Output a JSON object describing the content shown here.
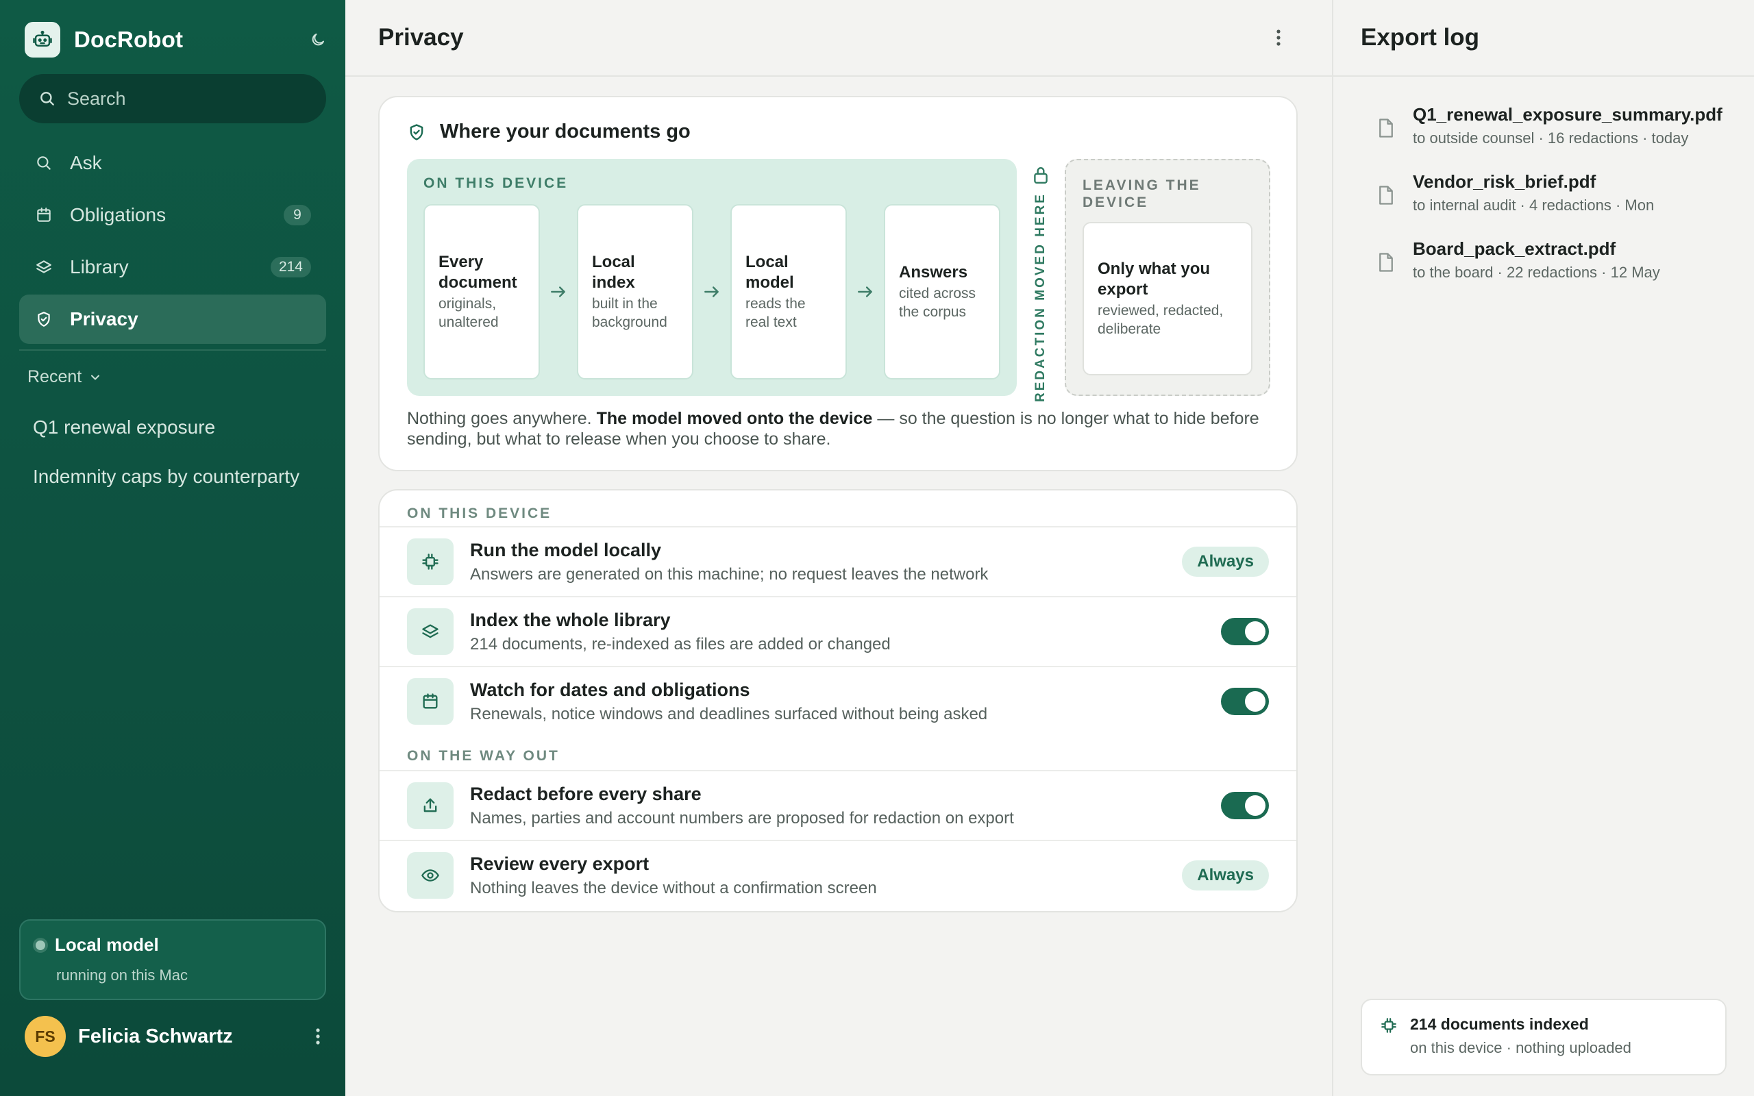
{
  "app": {
    "name": "DocRobot",
    "search_placeholder": "Search"
  },
  "sidebar": {
    "nav": [
      {
        "label": "Ask",
        "icon": "search-icon"
      },
      {
        "label": "Obligations",
        "icon": "calendar-icon",
        "count": "9"
      },
      {
        "label": "Library",
        "icon": "layers-icon",
        "count": "214"
      },
      {
        "label": "Privacy",
        "icon": "shield-check-icon",
        "active": true
      }
    ],
    "recent_label": "Recent",
    "recent": [
      "Q1 renewal exposure",
      "Indemnity caps by counterparty"
    ],
    "local_model": {
      "title": "Local model",
      "subtitle": "running on this Mac"
    },
    "user": {
      "initials": "FS",
      "name": "Felicia Schwartz"
    }
  },
  "main": {
    "title": "Privacy",
    "flow": {
      "title": "Where your documents go",
      "device_label": "ON THIS DEVICE",
      "steps": [
        {
          "title": "Every document",
          "sub": "originals, unaltered"
        },
        {
          "title": "Local index",
          "sub": "built in the background"
        },
        {
          "title": "Local model",
          "sub": "reads the real text"
        },
        {
          "title": "Answers",
          "sub": "cited across the corpus"
        }
      ],
      "boundary_label": "REDACTION MOVED HERE",
      "leaving_label": "LEAVING THE DEVICE",
      "leaving_step": {
        "title": "Only what you export",
        "sub": "reviewed, redacted, deliberate"
      },
      "note_prefix": "Nothing goes anywhere. ",
      "note_bold": "The model moved onto the device",
      "note_suffix": " — so the question is no longer what to hide before sending, but what to release when you choose to share."
    },
    "settings": {
      "section_device": "ON THIS DEVICE",
      "section_out": "ON THE WAY OUT",
      "rows": [
        {
          "title": "Run the model locally",
          "sub": "Answers are generated on this machine; no request leaves the network",
          "control": "pill",
          "pill": "Always",
          "icon": "chip-icon"
        },
        {
          "title": "Index the whole library",
          "sub": "214 documents, re-indexed as files are added or changed",
          "control": "toggle",
          "on": true,
          "icon": "layers-icon"
        },
        {
          "title": "Watch for dates and obligations",
          "sub": "Renewals, notice windows and deadlines surfaced without being asked",
          "control": "toggle",
          "on": true,
          "icon": "calendar-icon"
        },
        {
          "title": "Redact before every share",
          "sub": "Names, parties and account numbers are proposed for redaction on export",
          "control": "toggle",
          "on": true,
          "icon": "upload-icon"
        },
        {
          "title": "Review every export",
          "sub": "Nothing leaves the device without a confirmation screen",
          "control": "pill",
          "pill": "Always",
          "icon": "eye-icon"
        }
      ]
    }
  },
  "export_log": {
    "title": "Export log",
    "items": [
      {
        "name": "Q1_renewal_exposure_summary.pdf",
        "meta": "to outside counsel · 16 redactions · today"
      },
      {
        "name": "Vendor_risk_brief.pdf",
        "meta": "to internal audit · 4 redactions · Mon"
      },
      {
        "name": "Board_pack_extract.pdf",
        "meta": "to the board · 22 redactions · 12 May"
      }
    ],
    "index_status": {
      "title": "214 documents indexed",
      "sub": "on this device · nothing uploaded"
    }
  },
  "colors": {
    "sidebar": "#0f5a45",
    "accent": "#1a6a51",
    "soft_accent": "#def0e8",
    "avatar": "#f4c14e"
  }
}
